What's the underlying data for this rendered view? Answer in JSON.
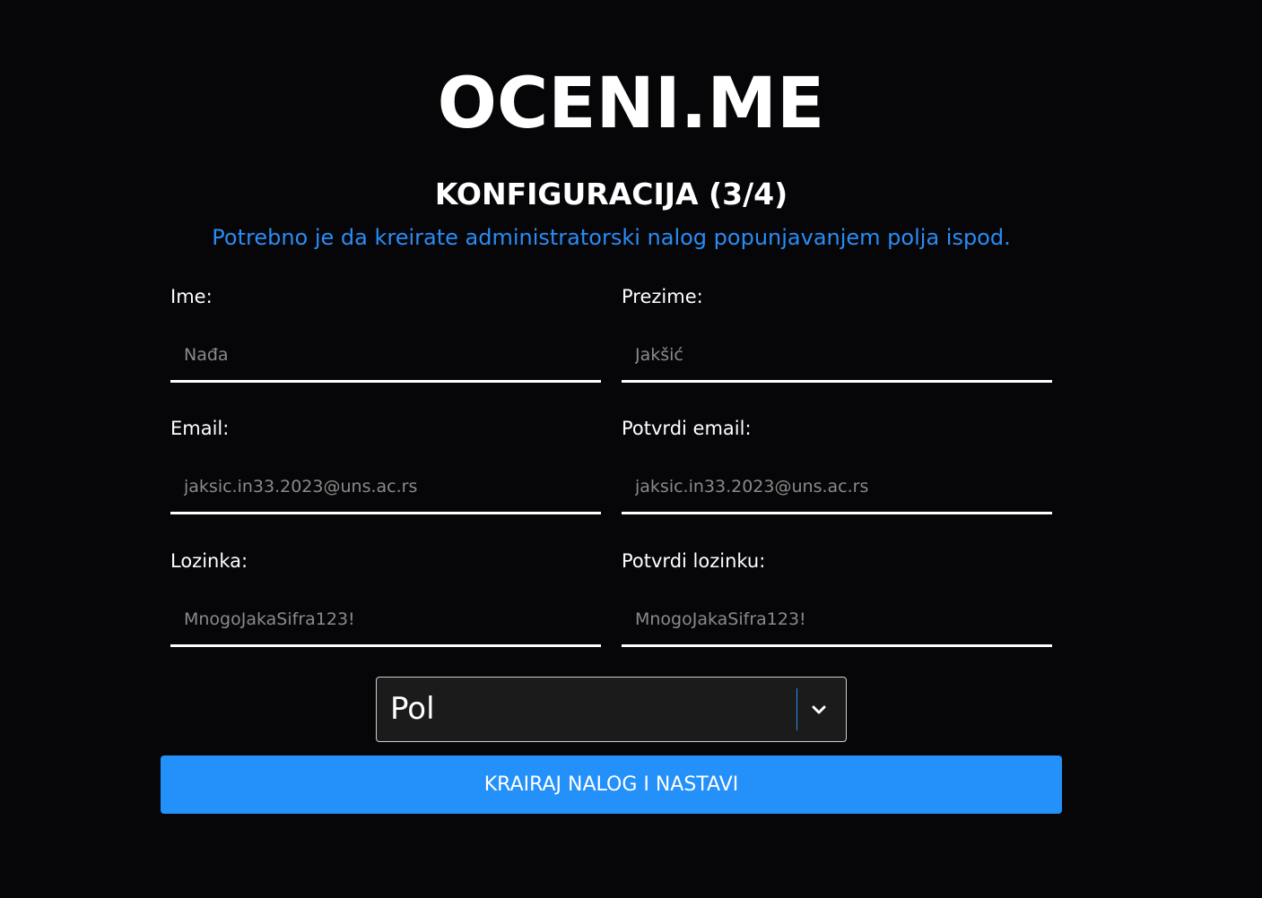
{
  "brand": "OCENI.ME",
  "step_title": "KONFIGURACIJA (3/4)",
  "subtitle": "Potrebno je da kreirate administratorski nalog popunjavanjem polja ispod.",
  "form": {
    "first_name": {
      "label": "Ime:",
      "placeholder": "Nađa",
      "value": ""
    },
    "last_name": {
      "label": "Prezime:",
      "placeholder": "Jakšić",
      "value": ""
    },
    "email": {
      "label": "Email:",
      "placeholder": "jaksic.in33.2023@uns.ac.rs",
      "value": ""
    },
    "confirm_email": {
      "label": "Potvrdi email:",
      "placeholder": "jaksic.in33.2023@uns.ac.rs",
      "value": ""
    },
    "password": {
      "label": "Lozinka:",
      "placeholder": "MnogoJakaSifra123!",
      "value": ""
    },
    "confirm_password": {
      "label": "Potvrdi lozinku:",
      "placeholder": "MnogoJakaSifra123!",
      "value": ""
    },
    "gender_select": {
      "selected": "Pol",
      "icon": "chevron-down-icon"
    },
    "submit_label": "KRAIRAJ NALOG I NASTAVI"
  },
  "colors": {
    "background": "#060608",
    "accent": "#2490fa",
    "subtitle": "#2a8cf5",
    "text": "#ffffff",
    "placeholder": "#8a8a8a"
  }
}
